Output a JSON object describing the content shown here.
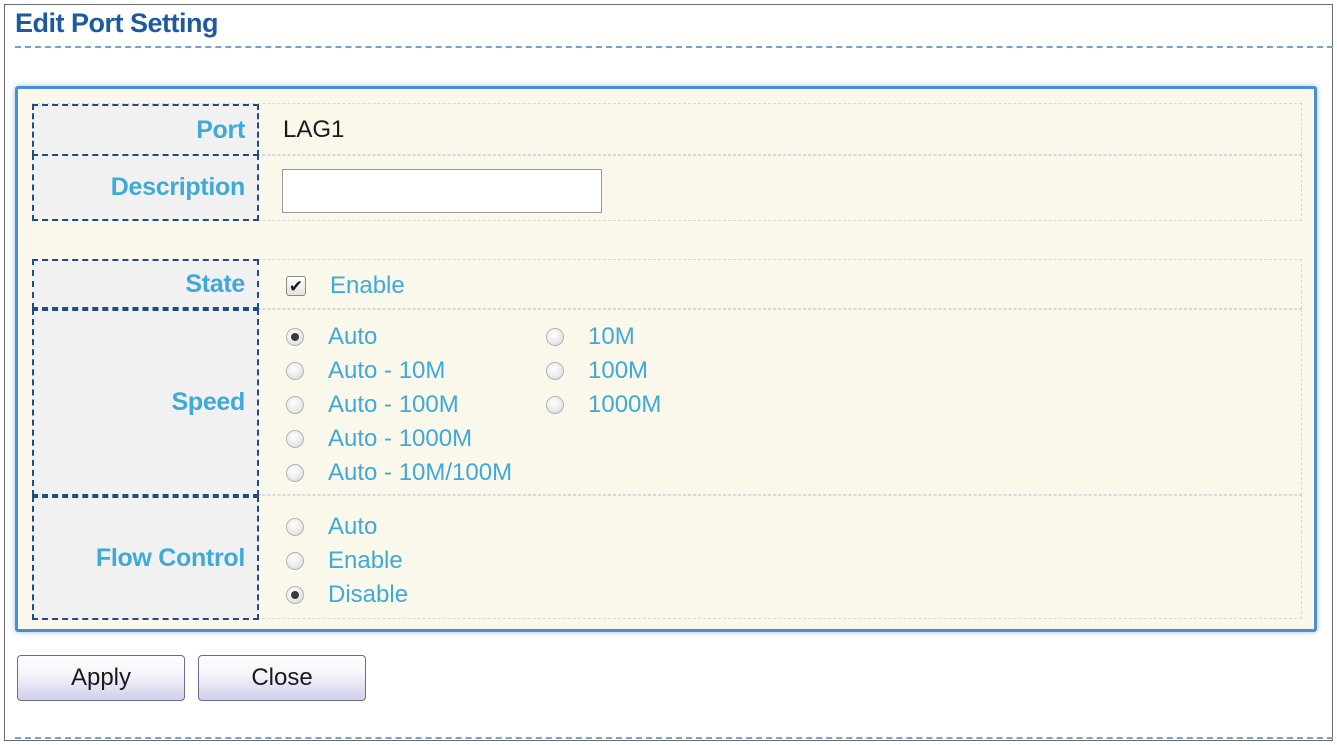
{
  "page": {
    "title": "Edit Port Setting"
  },
  "form": {
    "port": {
      "label": "Port",
      "value": "LAG1"
    },
    "description": {
      "label": "Description",
      "value": "",
      "placeholder": ""
    },
    "state": {
      "label": "State",
      "option_label": "Enable",
      "checked": true
    },
    "speed": {
      "label": "Speed",
      "options": [
        "Auto",
        "Auto - 10M",
        "Auto - 100M",
        "Auto - 1000M",
        "Auto - 10M/100M",
        "10M",
        "100M",
        "1000M"
      ],
      "selected": "Auto"
    },
    "flow_control": {
      "label": "Flow Control",
      "options": [
        "Auto",
        "Enable",
        "Disable"
      ],
      "selected": "Disable"
    }
  },
  "buttons": {
    "apply": "Apply",
    "close": "Close"
  },
  "colors": {
    "title": "#1f5a9e",
    "label_text": "#3fa9d8",
    "panel_border": "#4a8fd4",
    "panel_background": "#faf8ea",
    "label_cell_border": "#1e4d84"
  },
  "icons": {
    "state_checkbox": "checkmark-icon"
  }
}
